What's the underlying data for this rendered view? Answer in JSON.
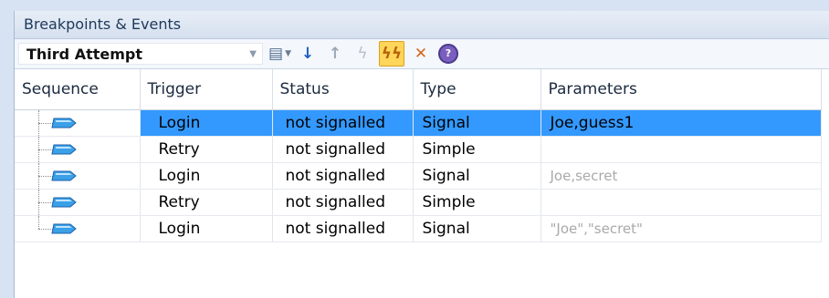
{
  "panel": {
    "title": "Breakpoints & Events"
  },
  "toolbar": {
    "sequence_combo_value": "Third Attempt",
    "combo_arrow_icon": "dropdown-arrow",
    "buttons": [
      {
        "name": "list-view",
        "glyph": "▤"
      },
      {
        "name": "move-down",
        "glyph": "🡇"
      },
      {
        "name": "move-up",
        "glyph": "🡅"
      },
      {
        "name": "signal",
        "glyph": "ϟ"
      },
      {
        "name": "signal-all",
        "glyph": "ϟϟ"
      },
      {
        "name": "delete",
        "glyph": "✕"
      },
      {
        "name": "help",
        "glyph": "?"
      }
    ]
  },
  "table": {
    "columns": [
      "Sequence",
      "Trigger",
      "Status",
      "Type",
      "Parameters"
    ],
    "rows": [
      {
        "trigger": "Login",
        "status": "not signalled",
        "type": "Signal",
        "parameters": "Joe,guess1",
        "selected": true,
        "params_faded": false
      },
      {
        "trigger": "Retry",
        "status": "not signalled",
        "type": "Simple",
        "parameters": "",
        "selected": false,
        "params_faded": false
      },
      {
        "trigger": "Login",
        "status": "not signalled",
        "type": "Signal",
        "parameters": "Joe,secret",
        "selected": false,
        "params_faded": true
      },
      {
        "trigger": "Retry",
        "status": "not signalled",
        "type": "Simple",
        "parameters": "",
        "selected": false,
        "params_faded": false
      },
      {
        "trigger": "Login",
        "status": "not signalled",
        "type": "Signal",
        "parameters": "\"Joe\",\"secret\"",
        "selected": false,
        "params_faded": true
      }
    ]
  },
  "colors": {
    "selection": "#3399ff",
    "active_button": "#ffd55a",
    "event_icon": "#3aa0e8"
  }
}
